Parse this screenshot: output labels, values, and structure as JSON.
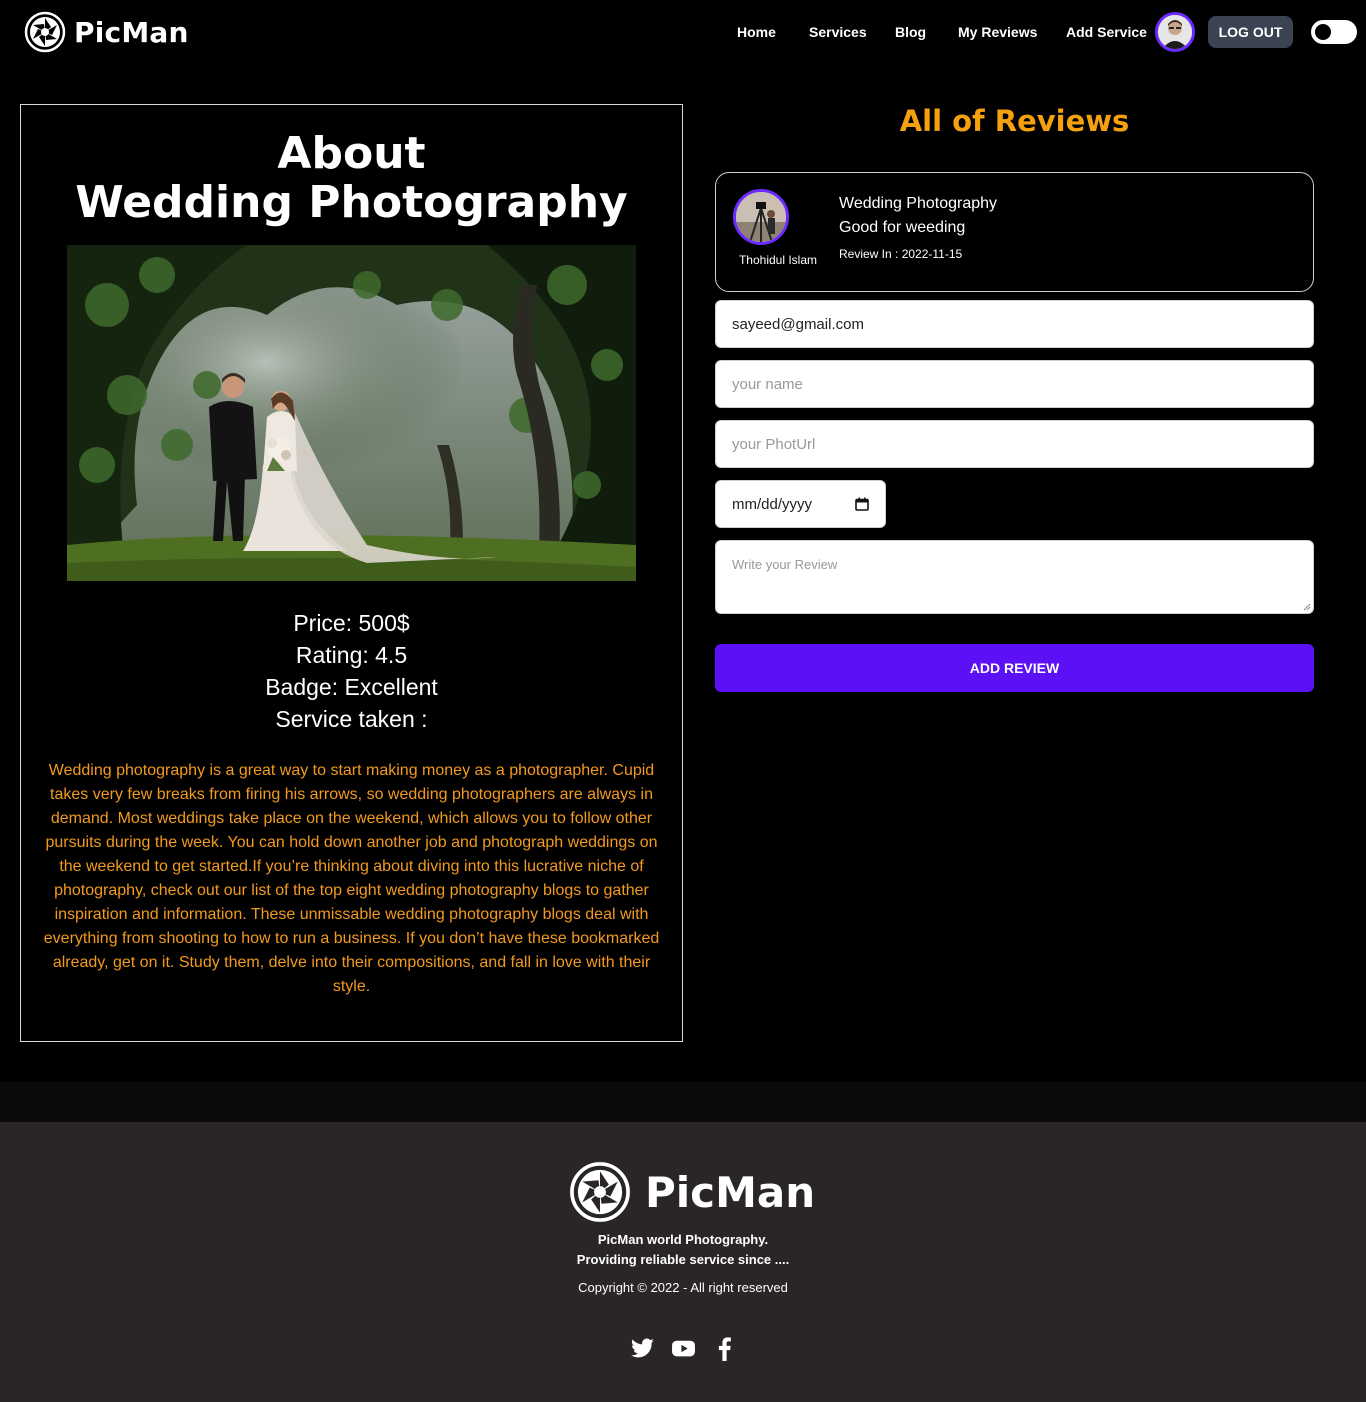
{
  "nav": {
    "brand": "PicMan",
    "links": [
      {
        "label": "Home"
      },
      {
        "label": "Services"
      },
      {
        "label": "Blog"
      },
      {
        "label": "My Reviews"
      },
      {
        "label": "Add Service"
      }
    ],
    "logout_label": "LOG OUT",
    "theme_toggle": "dark-mode-toggle"
  },
  "about": {
    "title_line1": "About",
    "title_line2": "Wedding Photography",
    "image": "wedding-couple-photo",
    "price": "Price: 500$",
    "rating": "Rating: 4.5",
    "badge": "Badge: Excellent",
    "service_taken": "Service taken :",
    "description": "Wedding photography is a great way to start making money as a photographer. Cupid takes very few breaks from firing his arrows, so wedding photographers are always in demand. Most weddings take place on the weekend, which allows you to follow other pursuits during the week. You can hold down another job and photograph weddings on the weekend to get started.If you’re thinking about diving into this lucrative niche of photography, check out our list of the top eight wedding photography blogs to gather inspiration and information. These unmissable wedding photography blogs deal with everything from shooting to how to run a business. If you don’t have these bookmarked already, get on it. Study them, delve into their compositions, and fall in love with their style."
  },
  "reviews": {
    "title": "All of Reviews",
    "items": [
      {
        "reviewer": "Thohidul Islam",
        "service": "Wedding Photography",
        "text": "Good for weeding",
        "date": "Review In : 2022-11-15"
      }
    ]
  },
  "form": {
    "email_value": "sayeed@gmail.com",
    "name_placeholder": "your name",
    "photo_placeholder": "your PhotUrl",
    "date_placeholder": "mm/dd/yyyy",
    "review_placeholder": "Write your Review",
    "submit_label": "ADD REVIEW"
  },
  "footer": {
    "brand": "PicMan",
    "tagline1": "PicMan world Photography.",
    "tagline2": "Providing reliable service since ....",
    "copyright": "Copyright © 2022 - All right reserved",
    "socials": [
      "twitter-icon",
      "youtube-icon",
      "facebook-icon"
    ]
  },
  "colors": {
    "accent_orange": "#f5a00f",
    "description_orange": "#f29a1f",
    "primary_purple": "#5b10f5",
    "footer_bg": "#2a2625"
  }
}
